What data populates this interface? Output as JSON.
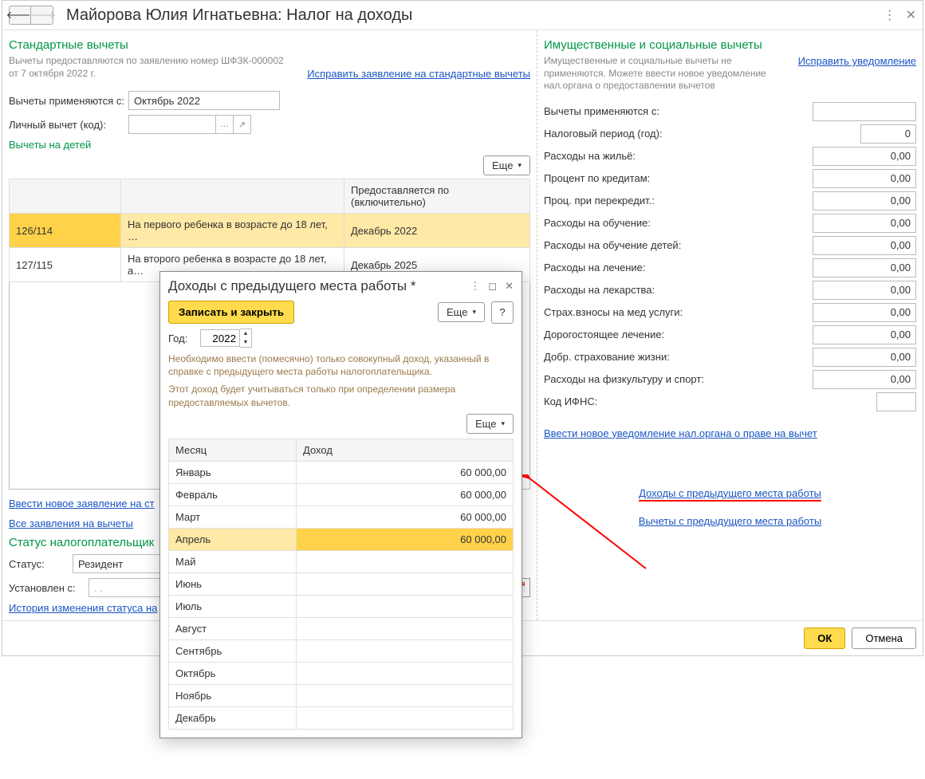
{
  "header": {
    "title": "Майорова Юлия Игнатьевна: Налог на доходы"
  },
  "left": {
    "section_title": "Стандартные вычеты",
    "hint1": "Вычеты предоставляются по заявлению номер ШФЗК-000002",
    "hint2": "от 7 октября 2022 г.",
    "fix_link": "Исправить заявление на стандартные вычеты",
    "applied_from_label": "Вычеты применяются с:",
    "applied_from_value": "Октябрь 2022",
    "personal_label": "Личный вычет (код):",
    "children_label": "Вычеты на детей",
    "more_btn": "Еще",
    "table": {
      "col_provided": "Предоставляется по (включительно)",
      "rows": [
        {
          "code": "126/114",
          "desc": "На первого ребенка в возрасте до 18 лет, …",
          "until": "Декабрь 2022"
        },
        {
          "code": "127/115",
          "desc": "На второго ребенка в возрасте до 18 лет, а…",
          "until": "Декабрь 2025"
        }
      ]
    },
    "new_app_link": "Ввести новое заявление на ст",
    "all_apps_link": "Все заявления на вычеты",
    "status_title": "Статус налогоплательщик",
    "status_label": "Статус:",
    "status_value": "Резидент",
    "set_from_label": "Установлен с:",
    "set_from_value": ". . ",
    "history_link": "История изменения статуса на"
  },
  "right": {
    "section_title": "Имущественные и социальные вычеты",
    "hint": "Имущественные и социальные вычеты не применяются. Можете ввести новое уведомление нал.органа о предоставлении вычетов",
    "fix_link": "Исправить уведомление",
    "applied_from_label": "Вычеты применяются с:",
    "tax_period_label": "Налоговый период (год):",
    "tax_period_value": "0",
    "fields": [
      {
        "label": "Расходы на жильё:",
        "value": "0,00"
      },
      {
        "label": "Процент по кредитам:",
        "value": "0,00"
      },
      {
        "label": "Проц. при перекредит.:",
        "value": "0,00"
      },
      {
        "label": "Расходы на обучение:",
        "value": "0,00"
      },
      {
        "label": "Расходы на обучение детей:",
        "value": "0,00"
      },
      {
        "label": "Расходы на лечение:",
        "value": "0,00"
      },
      {
        "label": "Расходы на лекарства:",
        "value": "0,00"
      },
      {
        "label": "Страх.взносы на мед услуги:",
        "value": "0,00"
      },
      {
        "label": "Дорогостоящее лечение:",
        "value": "0,00"
      },
      {
        "label": "Добр. страхование жизни:",
        "value": "0,00"
      },
      {
        "label": "Расходы на физкультуру и спорт:",
        "value": "0,00"
      }
    ],
    "ifns_label": "Код ИФНС:",
    "new_notice_link": "Ввести новое уведомление нал.органа о праве на вычет",
    "prev_income_link": "Доходы с предыдущего места работы",
    "prev_deduct_link": "Вычеты с предыдущего места работы"
  },
  "footer": {
    "ok": "ОК",
    "cancel": "Отмена"
  },
  "dialog": {
    "title": "Доходы с предыдущего места работы *",
    "record_btn": "Записать и закрыть",
    "more_btn": "Еще",
    "help": "?",
    "year_label": "Год:",
    "year_value": "2022",
    "hint1": "Необходимо ввести (помесячно) только совокупный доход, указанный в справке с предыдущего места работы налогоплательщика.",
    "hint2": "Этот доход будет учитываться только при определении размера предоставляемых вычетов.",
    "col_month": "Месяц",
    "col_income": "Доход",
    "rows": [
      {
        "month": "Январь",
        "income": "60 000,00"
      },
      {
        "month": "Февраль",
        "income": "60 000,00"
      },
      {
        "month": "Март",
        "income": "60 000,00"
      },
      {
        "month": "Апрель",
        "income": "60 000,00"
      },
      {
        "month": "Май",
        "income": ""
      },
      {
        "month": "Июнь",
        "income": ""
      },
      {
        "month": "Июль",
        "income": ""
      },
      {
        "month": "Август",
        "income": ""
      },
      {
        "month": "Сентябрь",
        "income": ""
      },
      {
        "month": "Октябрь",
        "income": ""
      },
      {
        "month": "Ноябрь",
        "income": ""
      },
      {
        "month": "Декабрь",
        "income": ""
      }
    ]
  }
}
